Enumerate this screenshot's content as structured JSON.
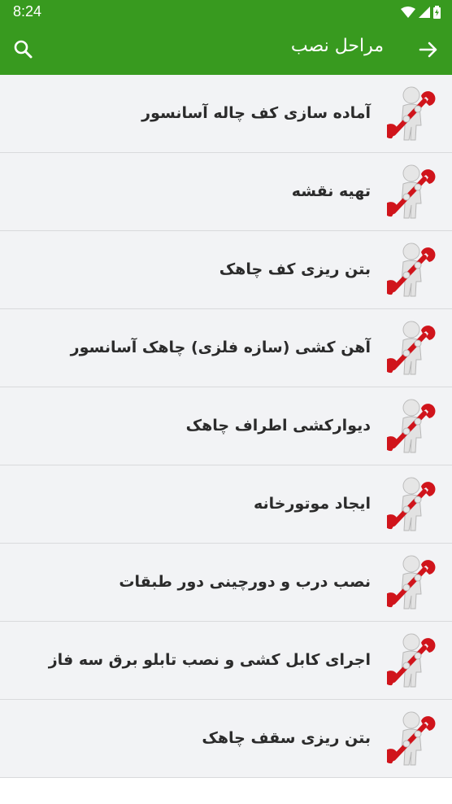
{
  "status": {
    "time": "8:24"
  },
  "appbar": {
    "title": "مراحل نصب",
    "back_icon": "arrow-forward-icon",
    "search_icon": "search-icon"
  },
  "colors": {
    "primary": "#389a1f",
    "row_bg": "#f2f3f5",
    "text": "#2b2b2b",
    "wrench": "#d0141b"
  },
  "list": {
    "items": [
      {
        "label": "آماده سازی کف چاله آسانسور"
      },
      {
        "label": "تهیه نقشه"
      },
      {
        "label": "بتن ریزی کف چاهک"
      },
      {
        "label": "آهن کشی (سازه فلزی) چاهک آسانسور"
      },
      {
        "label": "دیوارکشی اطراف چاهک"
      },
      {
        "label": "ایجاد موتورخانه"
      },
      {
        "label": "نصب درب و دورچینی دور طبقات"
      },
      {
        "label": "اجرای کابل کشی و نصب تابلو برق سه فاز"
      },
      {
        "label": "بتن ریزی سقف چاهک"
      }
    ]
  }
}
